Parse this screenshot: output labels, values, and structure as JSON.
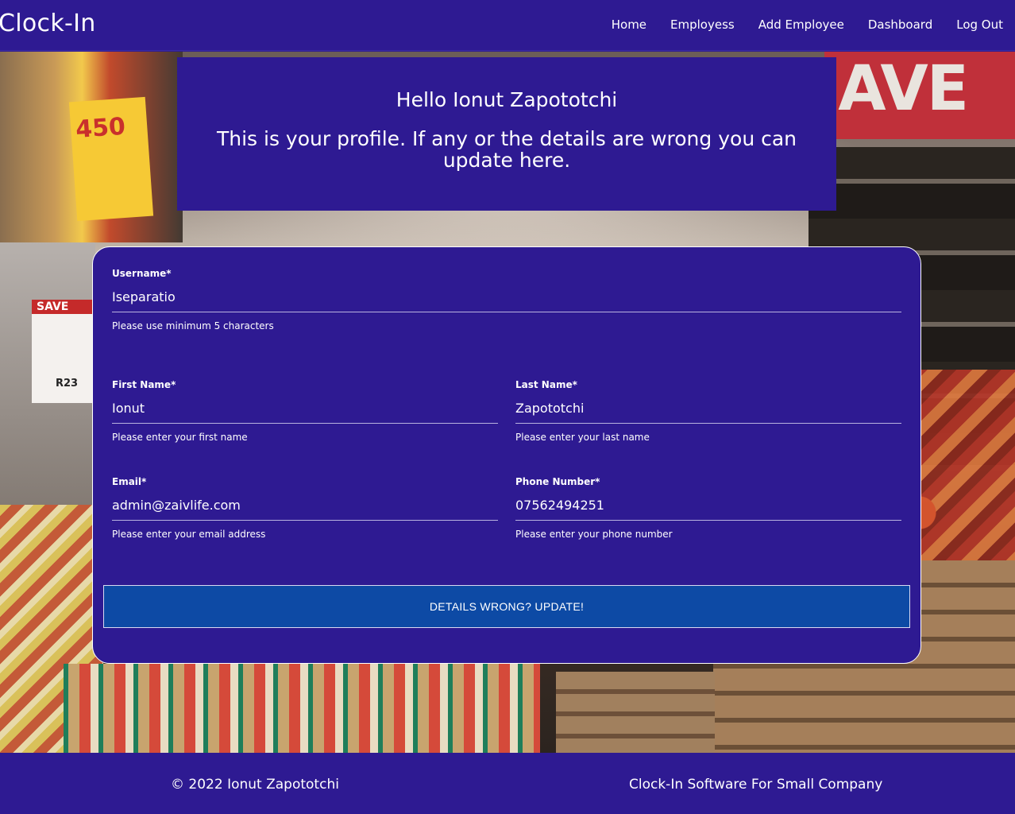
{
  "nav": {
    "brand": "Clock-In",
    "links": [
      "Home",
      "Employess",
      "Add Employee",
      "Dashboard",
      "Log Out"
    ]
  },
  "scene": {
    "sign_ave": "AVE",
    "sign_save": "SAVE",
    "sign_price": "R23",
    "sign_450": "450"
  },
  "header": {
    "greeting": "Hello Ionut Zapototchi",
    "subtitle": "This is your profile. If any or the details are wrong you can update here."
  },
  "form": {
    "username": {
      "label": "Username*",
      "value": "Iseparatio",
      "help": "Please use minimum 5 characters"
    },
    "first_name": {
      "label": "First Name*",
      "value": "Ionut",
      "help": "Please enter your first name"
    },
    "last_name": {
      "label": "Last Name*",
      "value": "Zapototchi",
      "help": "Please enter your last name"
    },
    "email": {
      "label": "Email*",
      "value": "admin@zaivlife.com",
      "help": "Please enter your email address"
    },
    "phone": {
      "label": "Phone Number*",
      "value": "07562494251",
      "help": "Please enter your phone number"
    },
    "submit_label": "DETAILS WRONG? UPDATE!"
  },
  "footer": {
    "copyright": "© 2022 Ionut Zapototchi",
    "tagline": "Clock-In Software For Small Company"
  },
  "colors": {
    "primary": "#2e1a92",
    "button": "#0d4aa5",
    "text": "#ffffff"
  }
}
